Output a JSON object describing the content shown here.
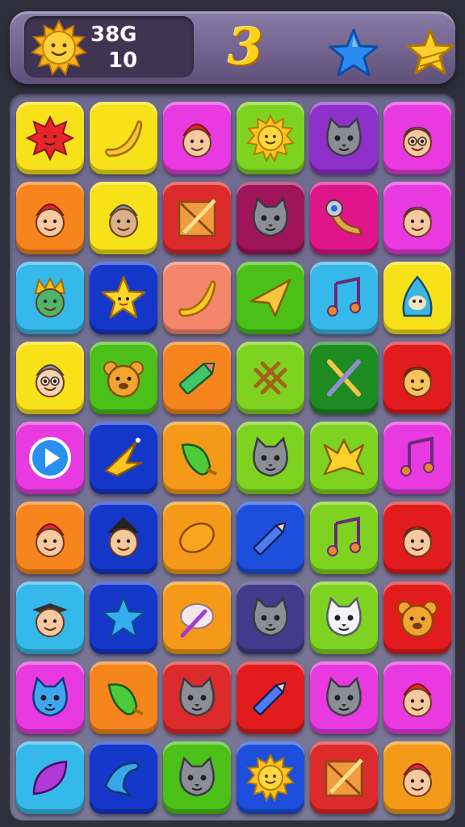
{
  "hud": {
    "score": "38G",
    "moves": "10",
    "level": "3",
    "colors": {
      "panel": "#3f3552",
      "level": "#ffd21c"
    }
  },
  "palette": {
    "yellow": "#f7e21a",
    "pink": "#e83ae0",
    "lime": "#7ed321",
    "purple": "#8e2fc9",
    "orange": "#f5851c",
    "red": "#dd2b2b",
    "maroon": "#a0145a",
    "magenta": "#e0158a",
    "cyan": "#35b8ea",
    "navy": "#1537c9",
    "salmon": "#f3866b",
    "green": "#4ac019",
    "darkgreen": "#1e8a22",
    "brightred": "#e21c1c",
    "amber": "#f59a18",
    "indigo": "#423a8a",
    "blue": "#1d4fdc"
  },
  "board": {
    "rows": [
      [
        {
          "color": "yellow",
          "icon": "red-star-burst-icon"
        },
        {
          "color": "yellow",
          "icon": "banana-icon"
        },
        {
          "color": "pink",
          "icon": "gnome-face-icon"
        },
        {
          "color": "lime",
          "icon": "sun-face-icon"
        },
        {
          "color": "purple",
          "icon": "cat-face-icon"
        },
        {
          "color": "pink",
          "icon": "man-glasses-face-icon"
        }
      ],
      [
        {
          "color": "orange",
          "icon": "gnome-face-icon"
        },
        {
          "color": "yellow",
          "icon": "bald-man-icon"
        },
        {
          "color": "red",
          "icon": "crossed-pencil-crate-icon"
        },
        {
          "color": "maroon",
          "icon": "cat-face-icon"
        },
        {
          "color": "magenta",
          "icon": "horn-eye-icon"
        },
        {
          "color": "pink",
          "icon": "boy-face-icon"
        }
      ],
      [
        {
          "color": "cyan",
          "icon": "crowned-goblin-icon"
        },
        {
          "color": "navy",
          "icon": "yellow-star-icon"
        },
        {
          "color": "salmon",
          "icon": "banana-icon"
        },
        {
          "color": "green",
          "icon": "paper-plane-icon"
        },
        {
          "color": "cyan",
          "icon": "music-note-icon"
        },
        {
          "color": "yellow",
          "icon": "hooded-creature-icon"
        }
      ],
      [
        {
          "color": "yellow",
          "icon": "woman-glasses-face-icon"
        },
        {
          "color": "green",
          "icon": "bear-face-icon"
        },
        {
          "color": "orange",
          "icon": "crayon-icon"
        },
        {
          "color": "lime",
          "icon": "lattice-icon"
        },
        {
          "color": "darkgreen",
          "icon": "crossed-tools-icon"
        },
        {
          "color": "brightred",
          "icon": "child-face-icon"
        }
      ],
      [
        {
          "color": "pink",
          "icon": "play-button-icon"
        },
        {
          "color": "navy",
          "icon": "shooting-star-icon"
        },
        {
          "color": "amber",
          "icon": "green-pepper-icon"
        },
        {
          "color": "lime",
          "icon": "cat-face-icon"
        },
        {
          "color": "lime",
          "icon": "arrow-star-icon"
        },
        {
          "color": "pink",
          "icon": "music-note-icon"
        }
      ],
      [
        {
          "color": "orange",
          "icon": "gnome-face-icon"
        },
        {
          "color": "navy",
          "icon": "witch-face-icon"
        },
        {
          "color": "amber",
          "icon": "lemon-icon"
        },
        {
          "color": "blue",
          "icon": "pencil-icon"
        },
        {
          "color": "lime",
          "icon": "music-note-icon"
        },
        {
          "color": "brightred",
          "icon": "boy-face-icon"
        }
      ],
      [
        {
          "color": "cyan",
          "icon": "graduate-face-icon"
        },
        {
          "color": "navy",
          "icon": "blue-star-icon"
        },
        {
          "color": "amber",
          "icon": "brain-pencil-icon"
        },
        {
          "color": "indigo",
          "icon": "cat-face-icon"
        },
        {
          "color": "lime",
          "icon": "white-cat-icon"
        },
        {
          "color": "brightred",
          "icon": "bear-face-icon"
        }
      ],
      [
        {
          "color": "pink",
          "icon": "blue-cat-icon"
        },
        {
          "color": "orange",
          "icon": "green-pepper-icon"
        },
        {
          "color": "red",
          "icon": "cat-face-icon"
        },
        {
          "color": "brightred",
          "icon": "pencil-icon"
        },
        {
          "color": "pink",
          "icon": "cat-face-icon"
        },
        {
          "color": "pink",
          "icon": "gnome-face-icon"
        }
      ],
      [
        {
          "color": "cyan",
          "icon": "purple-leaf-icon"
        },
        {
          "color": "navy",
          "icon": "dolphin-icon"
        },
        {
          "color": "green",
          "icon": "cat-face-icon"
        },
        {
          "color": "blue",
          "icon": "sun-face-icon"
        },
        {
          "color": "red",
          "icon": "crossed-pencil-crate-icon"
        },
        {
          "color": "amber",
          "icon": "gnome-face-icon"
        }
      ]
    ]
  }
}
